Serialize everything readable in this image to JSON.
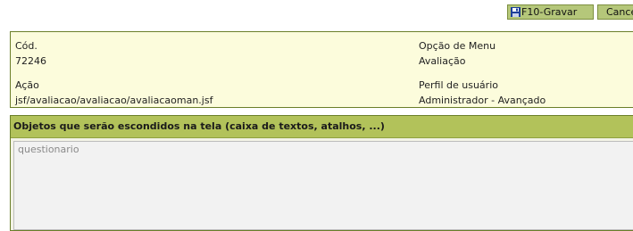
{
  "toolbar": {
    "save_label": "F10-Gravar",
    "cancel_label": "Cancelar"
  },
  "info": {
    "cod_label": "Cód.",
    "cod_value": "72246",
    "opcao_label": "Opção de Menu",
    "opcao_value": "Avaliação",
    "acao_label": "Ação",
    "acao_value": "jsf/avaliacao/avaliacao/avaliacaoman.jsf",
    "perfil_label": "Perfil de usuário",
    "perfil_value": "Administrador - Avançado"
  },
  "hidden_objects": {
    "title": "Objetos que serão escondidos na tela (caixa de textos, atalhos, ...)",
    "value": "questionario"
  },
  "icons": {
    "save": "floppy-disk-icon"
  },
  "colors": {
    "button_bg": "#b5c77a",
    "panel_bg": "#fcfcdc",
    "header_bg": "#b2c25a",
    "border": "#6b7f2a"
  }
}
